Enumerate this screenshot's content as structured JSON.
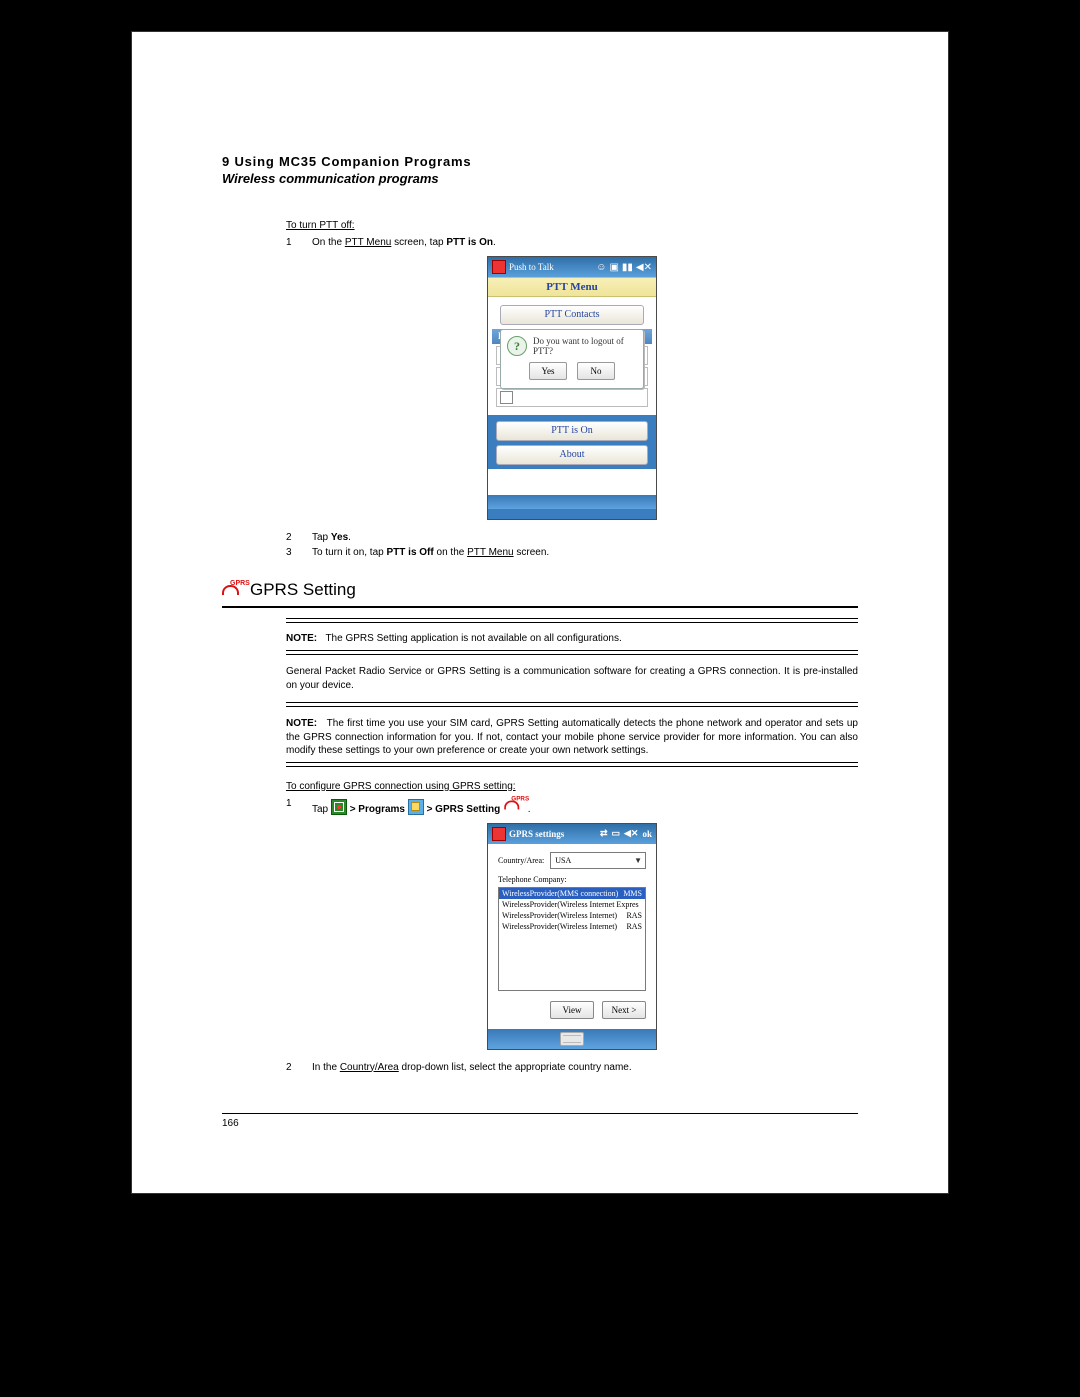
{
  "header": {
    "chapter": "9 Using MC35 Companion Programs",
    "section": "Wireless communication programs"
  },
  "ptt": {
    "proc_off_title": "To turn PTT off:",
    "steps_off": {
      "n1": "1",
      "t1a": "On the ",
      "t1u": "PTT Menu",
      "t1b": " screen, tap ",
      "t1bold": "PTT is On",
      "t1c": "."
    },
    "device": {
      "title": "Push to Talk",
      "menu_head": "PTT Menu",
      "contacts": "PTT Contacts",
      "service": "PTT Service",
      "dlg_text": "Do you want to logout of PTT?",
      "yes": "Yes",
      "no": "No",
      "ison": "PTT is On",
      "about": "About"
    },
    "steps_after": {
      "n2": "2",
      "t2a": "Tap ",
      "t2bold": "Yes",
      "t2b": ".",
      "n3": "3",
      "t3a": "To turn it on, tap ",
      "t3bold": "PTT is Off",
      "t3b": " on the ",
      "t3u": "PTT Menu",
      "t3c": " screen."
    }
  },
  "gprs": {
    "heading": "GPRS Setting",
    "note1_label": "NOTE:",
    "note1_text": "The GPRS Setting application is not available on all configurations.",
    "para": "General Packet Radio Service or GPRS Setting is a communication software for creating a GPRS connection. It is pre-installed on your device.",
    "note2_label": "NOTE:",
    "note2_text": "The first time you use your SIM card, GPRS Setting automatically detects the phone network and operator and sets up the GPRS connection information for you. If not, contact your mobile phone service provider for more information. You can also modify these settings to your own preference or create your own network settings.",
    "proc_title": "To configure GPRS connection using GPRS setting:",
    "step1": {
      "n": "1",
      "a": "Tap ",
      "b": " > Programs ",
      "c": " > GPRS Setting ",
      "d": "."
    },
    "step2": {
      "n": "2",
      "a": "In the ",
      "u": "Country/Area",
      "b": " drop-down list, select the appropriate country name."
    },
    "device": {
      "title": "GPRS settings",
      "ok": "ok",
      "label_country": "Country/Area:",
      "country_value": "USA",
      "label_company": "Telephone Company:",
      "rows": [
        {
          "l": "WirelessProvider(MMS connection)",
          "r": "MMS",
          "sel": true
        },
        {
          "l": "WirelessProvider(Wireless Internet Expres",
          "r": "",
          "sel": false
        },
        {
          "l": "WirelessProvider(Wireless Internet)",
          "r": "RAS",
          "sel": false
        },
        {
          "l": "WirelessProvider(Wireless Internet)",
          "r": "RAS",
          "sel": false
        }
      ],
      "view": "View",
      "next": "Next >"
    }
  },
  "page_number": "166"
}
